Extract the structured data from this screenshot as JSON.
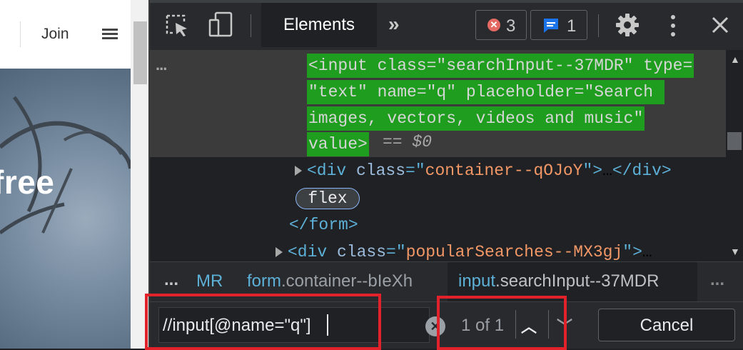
{
  "webpage": {
    "join_label": "Join",
    "hero_text": "free"
  },
  "devtools": {
    "active_tab": "Elements",
    "more_tabs_symbol": "»",
    "errors_count": "3",
    "messages_count": "1",
    "dom": {
      "collapsed_indicator": "...",
      "selected_lines": [
        "<input class=\"searchInput--37MDR\" type=",
        "\"text\" name=\"q\" placeholder=\"Search ",
        "images, vectors, videos and music\"",
        "value>"
      ],
      "selected_suffix": "== $0",
      "div_container_class": "container--qOJoY",
      "flex_badge": "flex",
      "form_close": "</form>",
      "div_popular_class": "popularSearches--MX3gj"
    },
    "breadcrumbs": {
      "left_ellipsis": "...",
      "crumb_1": "MR",
      "crumb_2_tag": "form",
      "crumb_2_class": ".container--bIeXh",
      "crumb_3_tag": "input",
      "crumb_3_class": ".searchInput--37MDR",
      "right_ellipsis": "..."
    },
    "search": {
      "query": "//input[@name=\"q\"]",
      "match_count": "1 of 1",
      "cancel_label": "Cancel"
    }
  },
  "colors": {
    "highlight_green": "#1f9d1f",
    "annotation_red": "#e2222a",
    "devtools_bg": "#202124"
  }
}
